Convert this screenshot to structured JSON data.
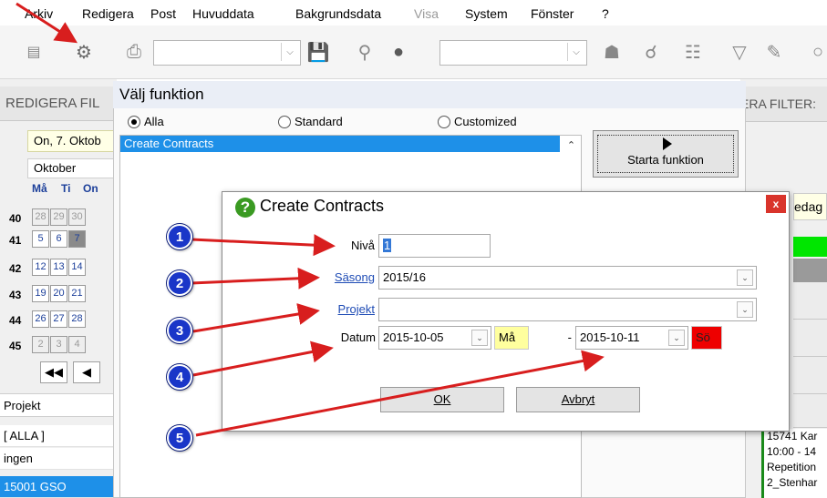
{
  "menu": [
    "Arkiv",
    "Redigera",
    "Post",
    "Huvuddata",
    "Bakgrundsdata",
    "Visa",
    "System",
    "Fönster",
    "?"
  ],
  "menu_disabled": "Visa",
  "left_panel": {
    "header": "REDIGERA FIL",
    "date": "On, 7. Oktob",
    "month": "Oktober",
    "day_headers": [
      "Må",
      "Ti",
      "On"
    ],
    "weeks": [
      {
        "week": "40",
        "days": [
          "28",
          "29",
          "30"
        ]
      },
      {
        "week": "41",
        "days": [
          "5",
          "6",
          "7"
        ]
      },
      {
        "week": "42",
        "days": [
          "12",
          "13",
          "14"
        ]
      },
      {
        "week": "43",
        "days": [
          "19",
          "20",
          "21"
        ]
      },
      {
        "week": "44",
        "days": [
          "26",
          "27",
          "28"
        ]
      },
      {
        "week": "45",
        "days": [
          "2",
          "3",
          "4"
        ]
      }
    ],
    "project_label": "Projekt",
    "list": [
      "[ ALLA ]",
      "ingen",
      "15001 GSO"
    ]
  },
  "right_panel": {
    "header": "ERA FILTER:",
    "yellow_text": "edag",
    "event_lines": [
      "15741 Kar",
      "10:00 - 14",
      "Repetition",
      "2_Stenhar"
    ]
  },
  "function_window": {
    "title": "Välj funktion",
    "radios": [
      {
        "label": "Alla",
        "checked": true
      },
      {
        "label": "Standard",
        "checked": false
      },
      {
        "label": "Customized",
        "checked": false
      }
    ],
    "items": [
      "Create Contracts"
    ],
    "start_button": "Starta funktion"
  },
  "dialog": {
    "title": "Create Contracts",
    "close": "x",
    "fields": {
      "niva_label": "Nivå",
      "niva_value": "1",
      "sasong_label": "Säsong",
      "sasong_value": "2015/16",
      "projekt_label": "Projekt",
      "projekt_value": "",
      "datum_label": "Datum",
      "date_from": "2015-10-05",
      "day_from": "Må",
      "separator": "-",
      "date_to": "2015-10-11",
      "day_to": "Sö"
    },
    "ok_label": "OK",
    "cancel_label": "Avbryt"
  },
  "annotations": [
    "1",
    "2",
    "3",
    "4",
    "5"
  ],
  "colors": {
    "selection_blue": "#1e90e8",
    "badge_blue": "#1a36c8",
    "arrow_red": "#d81e1e",
    "day_from_bg": "#ffff9e",
    "day_to_bg": "#ee0000",
    "green_bar": "#00e600"
  }
}
